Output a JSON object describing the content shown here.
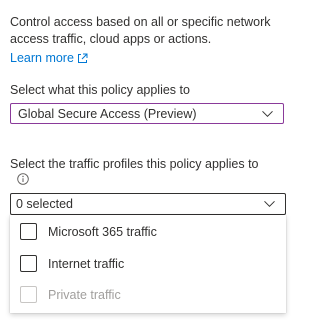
{
  "policy_panel": {
    "description": "Control access based on all or specific network access traffic, cloud apps or actions.",
    "learn_more": "Learn more",
    "applies_to_label": "Select what this policy applies to",
    "applies_to_value": "Global Secure Access (Preview)",
    "traffic_profiles_label": "Select the traffic profiles this policy applies to",
    "traffic_profiles_value": "0 selected",
    "traffic_options": [
      {
        "label": "Microsoft 365 traffic",
        "checked": false,
        "disabled": false
      },
      {
        "label": "Internet traffic",
        "checked": false,
        "disabled": false
      },
      {
        "label": "Private traffic",
        "checked": false,
        "disabled": true
      }
    ]
  },
  "colors": {
    "link": "#0078d4",
    "focus_border": "#8a3a9a",
    "text": "#323130",
    "disabled_text": "#a19f9d"
  },
  "icons": {
    "external_link": "external-link-icon",
    "chevron": "chevron-down-icon",
    "info": "info-icon"
  }
}
